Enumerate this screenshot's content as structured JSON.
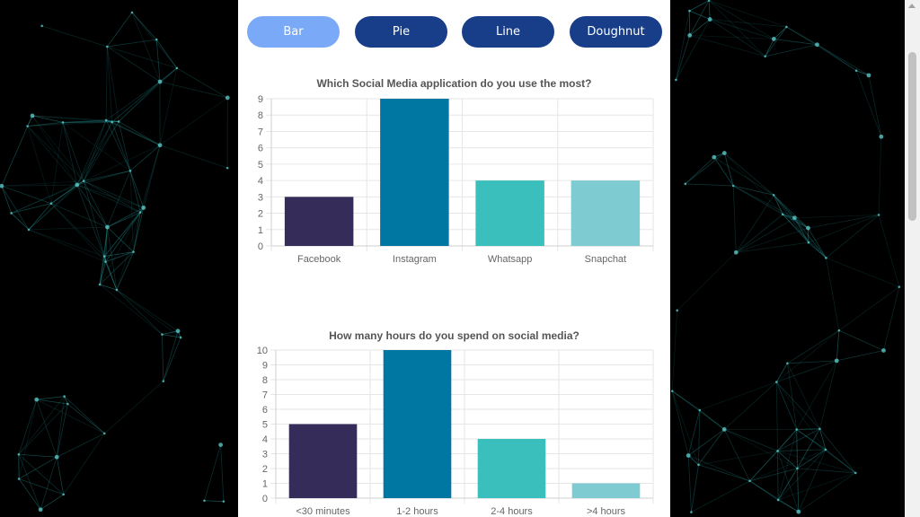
{
  "nav": {
    "buttons": [
      {
        "label": "Bar",
        "active": true
      },
      {
        "label": "Pie",
        "active": false
      },
      {
        "label": "Line",
        "active": false
      },
      {
        "label": "Doughnut",
        "active": false
      }
    ],
    "active_color": "#7aa9f7",
    "inactive_color": "#183e8a"
  },
  "colors": {
    "bar_palette": [
      "#352c59",
      "#0076a3",
      "#3bbfbd",
      "#7ecbd1"
    ]
  },
  "chart_data": [
    {
      "type": "bar",
      "title": "Which Social Media application do you use the most?",
      "categories": [
        "Facebook",
        "Instagram",
        "Whatsapp",
        "Snapchat"
      ],
      "values": [
        3,
        9,
        4,
        4
      ],
      "ylim": [
        0,
        9
      ],
      "yticks": [
        0,
        1,
        2,
        3,
        4,
        5,
        6,
        7,
        8,
        9
      ],
      "xlabel": "",
      "ylabel": "",
      "grid": true
    },
    {
      "type": "bar",
      "title": "How many hours do you spend on social media?",
      "categories": [
        "<30 minutes",
        "1-2 hours",
        "2-4 hours",
        ">4 hours"
      ],
      "values": [
        5,
        10,
        4,
        1
      ],
      "ylim": [
        0,
        10
      ],
      "yticks": [
        0,
        1,
        2,
        3,
        4,
        5,
        6,
        7,
        8,
        9,
        10
      ],
      "xlabel": "",
      "ylabel": "",
      "grid": true
    }
  ]
}
